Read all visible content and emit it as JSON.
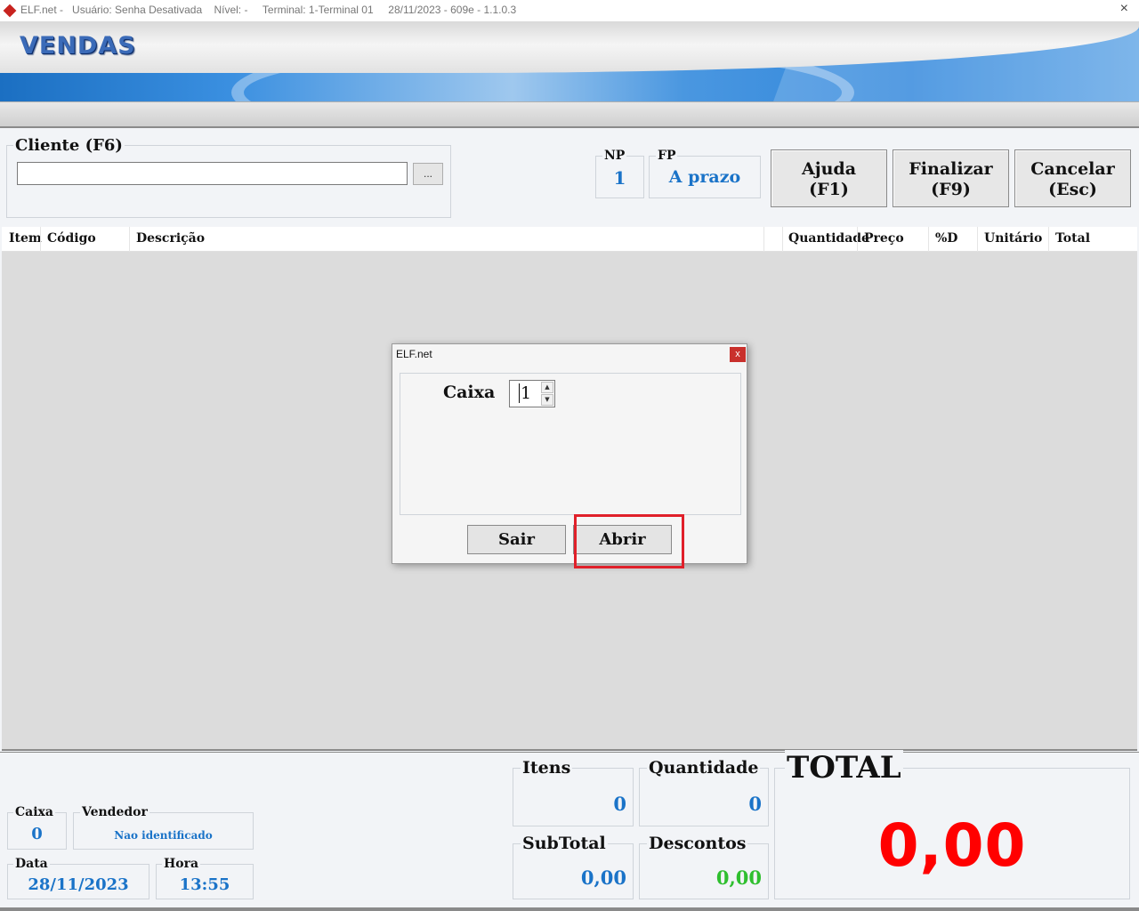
{
  "window": {
    "title": "ELF.net -   Usuário: Senha Desativada    Nível: -     Terminal: 1-Terminal 01     28/11/2023 - 609e - 1.1.0.3",
    "close_glyph": "×"
  },
  "banner": {
    "title": "VENDAS"
  },
  "cliente": {
    "label": "Cliente (F6)",
    "value": "",
    "browse_label": "..."
  },
  "np": {
    "label": "NP",
    "value": "1"
  },
  "fp": {
    "label": "FP",
    "value": "A prazo"
  },
  "buttons": {
    "ajuda": {
      "line1": "Ajuda",
      "line2": "(F1)"
    },
    "finalizar": {
      "line1": "Finalizar",
      "line2": "(F9)"
    },
    "cancelar": {
      "line1": "Cancelar",
      "line2": "(Esc)"
    }
  },
  "grid": {
    "columns": [
      "Item",
      "Código",
      "Descrição",
      "Quantidade",
      "Preço",
      "%D",
      "Unitário",
      "Total"
    ]
  },
  "dialog": {
    "title": "ELF.net",
    "close_label": "x",
    "caixa_label": "Caixa",
    "caixa_value": "1",
    "sair_label": "Sair",
    "abrir_label": "Abrir"
  },
  "footer": {
    "caixa": {
      "label": "Caixa",
      "value": "0"
    },
    "vendedor": {
      "label": "Vendedor",
      "value": "Nao identificado"
    },
    "data": {
      "label": "Data",
      "value": "28/11/2023"
    },
    "hora": {
      "label": "Hora",
      "value": "13:55"
    },
    "itens": {
      "label": "Itens",
      "value": "0"
    },
    "quantidade": {
      "label": "Quantidade",
      "value": "0"
    },
    "subtotal": {
      "label": "SubTotal",
      "value": "0,00"
    },
    "descontos": {
      "label": "Descontos",
      "value": "0,00"
    },
    "total": {
      "label": "TOTAL",
      "value": "0,00"
    }
  },
  "colors": {
    "value_blue": "#1a73c8",
    "discount_green": "#2fbf2f",
    "total_red": "#ff0000",
    "highlight_red": "#e0202a"
  }
}
